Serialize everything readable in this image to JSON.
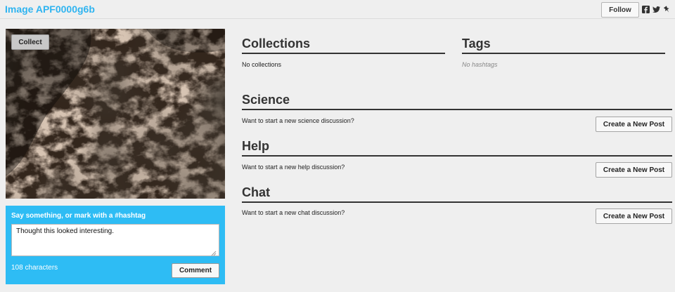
{
  "header": {
    "title": "Image APF0000g6b",
    "follow_label": "Follow",
    "share_icons": [
      "facebook-icon",
      "twitter-icon",
      "pin-icon"
    ]
  },
  "subject": {
    "collect_label": "Collect"
  },
  "comment": {
    "prompt": "Say something, or mark with a #hashtag",
    "value": "Thought this looked interesting.",
    "char_count": "108 characters",
    "submit_label": "Comment"
  },
  "collections": {
    "heading": "Collections",
    "empty_text": "No collections"
  },
  "tags": {
    "heading": "Tags",
    "empty_text": "No hashtags"
  },
  "boards": [
    {
      "heading": "Science",
      "prompt": "Want to start a new science discussion?",
      "button_label": "Create a New Post"
    },
    {
      "heading": "Help",
      "prompt": "Want to start a new help discussion?",
      "button_label": "Create a New Post"
    },
    {
      "heading": "Chat",
      "prompt": "Want to start a new chat discussion?",
      "button_label": "Create a New Post"
    }
  ],
  "colors": {
    "accent": "#2fb4f0",
    "comment_panel": "#2ebcf4"
  }
}
